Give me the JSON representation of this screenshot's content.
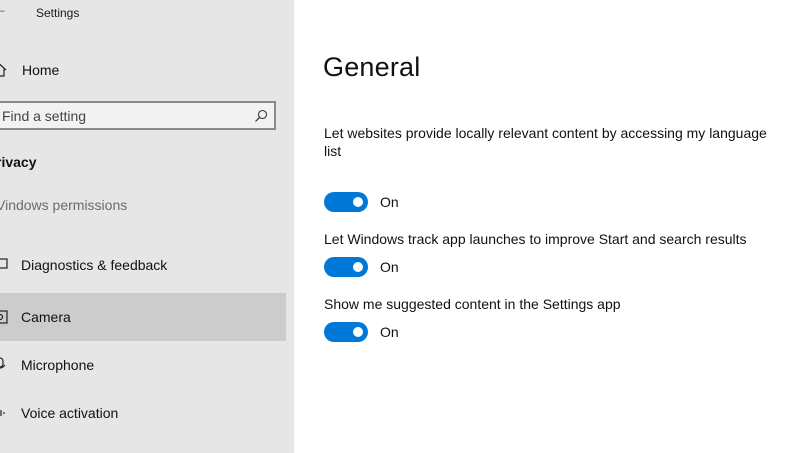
{
  "window": {
    "title": "Settings"
  },
  "sidebar": {
    "home_label": "Home",
    "search": {
      "placeholder": "Find a setting"
    },
    "section_heading": "rivacy",
    "subheading": "Vindows permissions",
    "items": [
      {
        "label": "Diagnostics & feedback",
        "icon": "diagnostics-icon"
      },
      {
        "label": "Camera",
        "icon": "camera-icon",
        "selected": true
      },
      {
        "label": "Microphone",
        "icon": "microphone-icon"
      },
      {
        "label": "Voice activation",
        "icon": "voice-icon"
      }
    ]
  },
  "main": {
    "title": "General",
    "settings": [
      {
        "label_line1": "Let websites provide locally relevant content by accessing my language",
        "label_line2": "list",
        "state": "On"
      },
      {
        "label": "Let Windows track app launches to improve Start and search results",
        "state": "On"
      },
      {
        "label": "Show me suggested content in the Settings app",
        "state": "On"
      }
    ]
  },
  "colors": {
    "accent": "#0078d7",
    "sidebar_bg": "#e6e6e6",
    "selected_bg": "#cccccc"
  }
}
